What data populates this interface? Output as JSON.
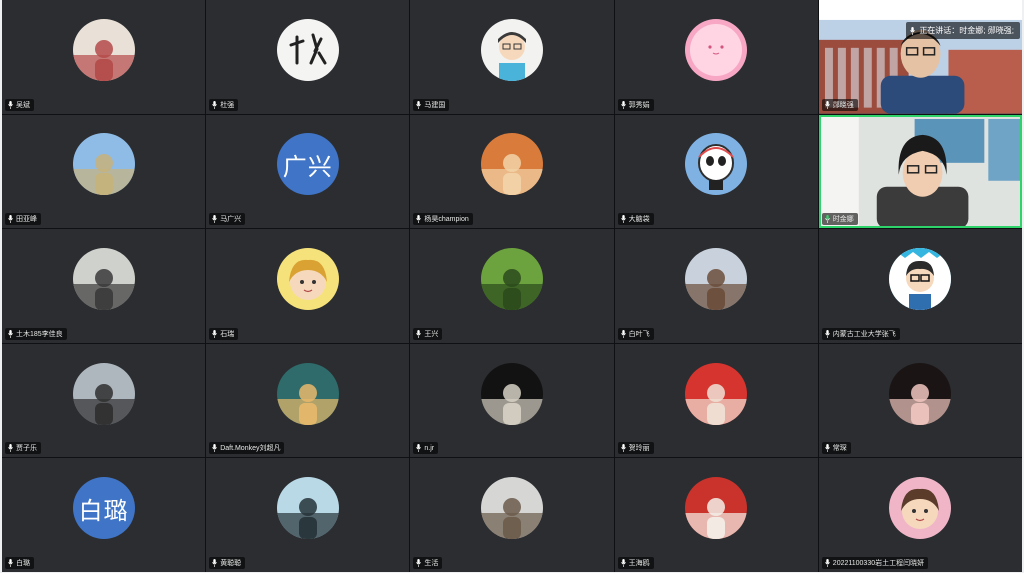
{
  "speaking_banner": {
    "text": "正在讲话：时金娜; 郧晓强;"
  },
  "participants": [
    {
      "name": "吴斌",
      "avatar_type": "photo",
      "colors": [
        "#e9e1d7",
        "#b44a4a"
      ]
    },
    {
      "name": "杜强",
      "avatar_type": "calligraphy",
      "colors": [
        "#f4f4f2",
        "#222222"
      ]
    },
    {
      "name": "马建国",
      "avatar_type": "cartoon-man",
      "colors": [
        "#f2f2f0",
        "#4ab3d9"
      ]
    },
    {
      "name": "郭秀娟",
      "avatar_type": "pink-blob",
      "colors": [
        "#f7a7c4",
        "#ffd5e4"
      ]
    },
    {
      "name": "郧晓强",
      "avatar_type": "video",
      "colors": [
        "#c8d6e5",
        "#9b4c3c"
      ]
    },
    {
      "name": "田亚峰",
      "avatar_type": "photo",
      "colors": [
        "#8fbce6",
        "#c7b27a"
      ]
    },
    {
      "name": "马广兴",
      "avatar_type": "text",
      "avatar_text": "广兴",
      "colors": [
        "#3f74c6",
        "#ffffff"
      ]
    },
    {
      "name": "杨昊champion",
      "avatar_type": "photo",
      "colors": [
        "#d97b3b",
        "#f2d4a8"
      ]
    },
    {
      "name": "大脑袋",
      "avatar_type": "panda",
      "colors": [
        "#7fb2e3",
        "#ffffff"
      ]
    },
    {
      "name": "时金娜",
      "avatar_type": "video",
      "colors": [
        "#dfe3e0",
        "#3b3b3b"
      ]
    },
    {
      "name": "土木185李佳良",
      "avatar_type": "photo",
      "colors": [
        "#cfd1cd",
        "#3a3a3a"
      ]
    },
    {
      "name": "石瑞",
      "avatar_type": "cartoon-girl",
      "colors": [
        "#f6e27a",
        "#d9a233"
      ]
    },
    {
      "name": "王兴",
      "avatar_type": "photo",
      "colors": [
        "#6da33e",
        "#2b4a1c"
      ]
    },
    {
      "name": "白叶飞",
      "avatar_type": "photo",
      "colors": [
        "#c9d2dc",
        "#6b4d3b"
      ]
    },
    {
      "name": "内蒙古工业大学张飞",
      "avatar_type": "cartoon-boy",
      "colors": [
        "#35b6e0",
        "#ffffff"
      ]
    },
    {
      "name": "贾子乐",
      "avatar_type": "photo",
      "colors": [
        "#aeb6be",
        "#2f2f2f"
      ]
    },
    {
      "name": "Daft.Monkey刘超凡",
      "avatar_type": "photo",
      "colors": [
        "#2e6b6a",
        "#e9b96b"
      ]
    },
    {
      "name": "n.jr",
      "avatar_type": "photo",
      "colors": [
        "#121212",
        "#d7d1c4"
      ]
    },
    {
      "name": "贺玲丽",
      "avatar_type": "photo",
      "colors": [
        "#d6342e",
        "#f0e2d6"
      ]
    },
    {
      "name": "常琛",
      "avatar_type": "photo",
      "colors": [
        "#1b1414",
        "#f1c7c0"
      ]
    },
    {
      "name": "白璐",
      "avatar_type": "text",
      "avatar_text": "白璐",
      "colors": [
        "#3f74c6",
        "#ffffff"
      ]
    },
    {
      "name": "黄聪聪",
      "avatar_type": "photo",
      "colors": [
        "#b9d9e6",
        "#263238"
      ]
    },
    {
      "name": "生活",
      "avatar_type": "photo",
      "colors": [
        "#d6d6d4",
        "#6b5b4b"
      ]
    },
    {
      "name": "王海鸥",
      "avatar_type": "photo",
      "colors": [
        "#c9332b",
        "#f3efe9"
      ]
    },
    {
      "name": "20221100330岩土工程闫晓妍",
      "avatar_type": "cartoon-girl",
      "colors": [
        "#f0b6c8",
        "#5b3c2b"
      ]
    }
  ]
}
